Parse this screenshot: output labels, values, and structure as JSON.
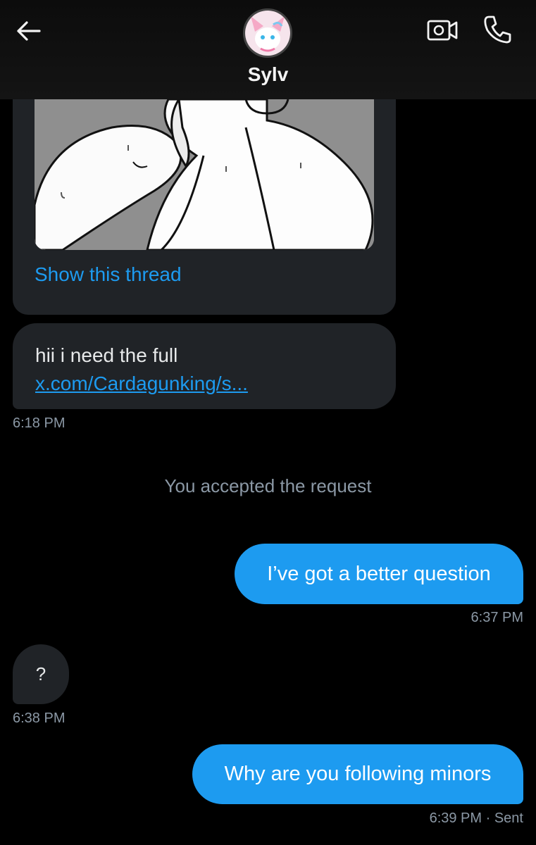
{
  "header": {
    "title": "Sylv",
    "back_icon": "arrow-left-icon",
    "video_icon": "video-camera-icon",
    "call_icon": "phone-icon"
  },
  "shared_post": {
    "show_thread": "Show this thread"
  },
  "messages": [
    {
      "direction": "in",
      "line1": "hii i need the full",
      "link": "x.com/Cardagunking/s...",
      "time": "6:18 PM"
    },
    {
      "direction": "system",
      "text": "You accepted the request"
    },
    {
      "direction": "out",
      "text": "I’ve got a better question",
      "time": "6:37 PM"
    },
    {
      "direction": "in",
      "text": "?",
      "time": "6:38 PM"
    },
    {
      "direction": "out",
      "text": "Why are you following minors",
      "time": "6:39 PM",
      "status": "Sent"
    }
  ],
  "colors": {
    "background": "#000000",
    "incoming_bubble": "#202327",
    "outgoing_bubble": "#1d9bf0",
    "link": "#1d9bf0",
    "muted_text": "#8b98a5"
  }
}
